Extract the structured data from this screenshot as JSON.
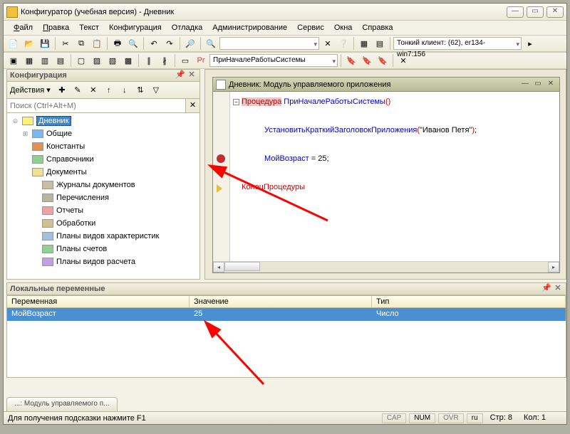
{
  "window_title": "Конфигуратор (учебная версия) - Дневник",
  "menu": [
    "Файл",
    "Правка",
    "Текст",
    "Конфигурация",
    "Отладка",
    "Администрирование",
    "Сервис",
    "Окна",
    "Справка"
  ],
  "menu_ul": [
    0,
    0,
    -1,
    -1,
    -1,
    -1,
    -1,
    -1,
    -1
  ],
  "toolbar_combo_empty": "",
  "toolbar_client": "Тонкий клиент: (62), er134-win7:156",
  "toolbar2_proc": "ПриНачалеРаботыСистемы",
  "config_panel": {
    "title": "Конфигурация",
    "actions_label": "Действия ",
    "search_placeholder": "Поиск (Ctrl+Alt+M)",
    "tree": [
      {
        "label": "Дневник",
        "indent": 0,
        "exp": "⊝",
        "icon": "#fff27a",
        "sel": true
      },
      {
        "label": "Общие",
        "indent": 1,
        "exp": "⊞",
        "icon": "#7ab8f0"
      },
      {
        "label": "Константы",
        "indent": 1,
        "exp": "",
        "icon": "#e09050"
      },
      {
        "label": "Справочники",
        "indent": 1,
        "exp": "",
        "icon": "#8fcf8f"
      },
      {
        "label": "Документы",
        "indent": 1,
        "exp": "",
        "icon": "#f0e090"
      },
      {
        "label": "Журналы документов",
        "indent": 2,
        "exp": "",
        "icon": "#c7bda0"
      },
      {
        "label": "Перечисления",
        "indent": 2,
        "exp": "",
        "icon": "#b8b59f"
      },
      {
        "label": "Отчеты",
        "indent": 2,
        "exp": "",
        "icon": "#f0a0a0"
      },
      {
        "label": "Обработки",
        "indent": 2,
        "exp": "",
        "icon": "#d0c090"
      },
      {
        "label": "Планы видов характеристик",
        "indent": 2,
        "exp": "",
        "icon": "#a0c0e0"
      },
      {
        "label": "Планы счетов",
        "indent": 2,
        "exp": "",
        "icon": "#90d090"
      },
      {
        "label": "Планы видов расчета",
        "indent": 2,
        "exp": "",
        "icon": "#c0a0e0"
      }
    ]
  },
  "code_panel": {
    "title": "Дневник: Модуль управляемого приложения",
    "lines": {
      "l1a": "Процедура",
      "l1b": " ПриНачалеРаботыСистемы",
      "l1c": "()",
      "l3a": "УстановитьКраткийЗаголовокПриложения",
      "l3b": "(",
      "l3c": "\"Иванов Петя\"",
      "l3d": ")",
      "l3e": ";",
      "l5a": "МойВозраст",
      "l5b": " = ",
      "l5c": "25",
      "l5d": ";",
      "l7": "КонецПроцедуры"
    }
  },
  "vars_panel": {
    "title": "Локальные переменные",
    "cols": [
      "Переменная",
      "Значение",
      "Тип"
    ],
    "row": {
      "name": "МойВозраст",
      "value": "25",
      "type": "Число"
    }
  },
  "tab_label": "...: Модуль управляемого п...",
  "status": {
    "hint": "Для получения подсказки нажмите F1",
    "cap": "CAP",
    "num": "NUM",
    "ovr": "OVR",
    "lang": "ru",
    "line_lbl": "Стр: ",
    "line_val": "8",
    "col_lbl": "Кол: ",
    "col_val": "1"
  }
}
